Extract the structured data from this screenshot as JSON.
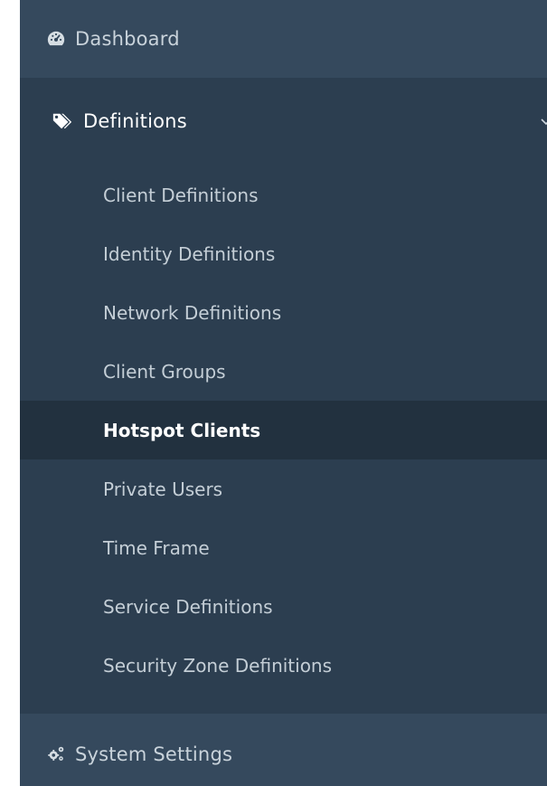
{
  "nav": {
    "dashboard": {
      "label": "Dashboard",
      "icon": "tachometer-icon"
    },
    "definitions": {
      "label": "Definitions",
      "icon": "tags-icon",
      "expanded": true,
      "items": [
        {
          "label": "Client Definitions",
          "active": false
        },
        {
          "label": "Identity Definitions",
          "active": false
        },
        {
          "label": "Network Definitions",
          "active": false
        },
        {
          "label": "Client Groups",
          "active": false
        },
        {
          "label": "Hotspot Clients",
          "active": true
        },
        {
          "label": "Private Users",
          "active": false
        },
        {
          "label": "Time Frame",
          "active": false
        },
        {
          "label": "Service Definitions",
          "active": false
        },
        {
          "label": "Security Zone Definitions",
          "active": false
        }
      ]
    },
    "system_settings": {
      "label": "System Settings",
      "icon": "cogs-icon"
    }
  },
  "colors": {
    "sidebar_bg": "#2c3e50",
    "top_item_bg": "#35495d",
    "active_bg": "#22313f",
    "text": "#c4ced6",
    "active_text": "#ffffff"
  }
}
